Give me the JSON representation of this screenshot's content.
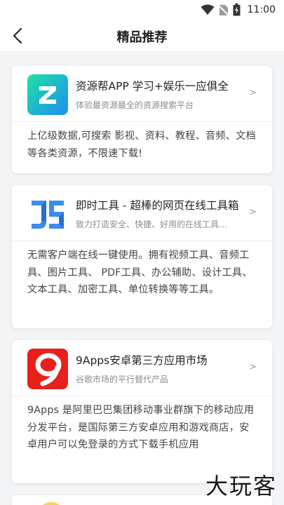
{
  "status_bar": {
    "time": "11:00",
    "icons": [
      "wifi-icon",
      "no-sim-icon",
      "battery-icon"
    ]
  },
  "nav": {
    "title": "精品推荐",
    "back_icon": "chevron-left-icon"
  },
  "cards": [
    {
      "icon": "z-logo",
      "title": "资源帮APP 学习+娱乐一应俱全",
      "subtitle": "体验最资源最全的资源搜索平台",
      "chevron": ">",
      "description": "上亿级数据,可搜索 影视、资料、教程、音频、文档 等各类资源，不限速下载!"
    },
    {
      "icon": "js-logo",
      "title": "即时工具 - 超棒的网页在线工具箱",
      "subtitle": "致力打造安全、快捷、好用的在线工具…",
      "chevron": ">",
      "description": "无需客户端在线一键使用。拥有视频工具、音频工具、图片工具、 PDF工具、办公辅助、设计工具、文本工具、加密工具、单位转换等等工具。"
    },
    {
      "icon": "9apps-logo",
      "title": "9Apps安卓第三方应用市场",
      "subtitle": "谷歌市场的平行替代产品",
      "chevron": ">",
      "description": "9Apps 是阿里巴巴集团移动事业群旗下的移动应用分发平台，是国际第三方安卓应用和游戏商店，安卓用户可以免登录的方式下载手机应用"
    }
  ],
  "watermark": [
    "大",
    "玩",
    "客"
  ],
  "colors": {
    "background": "#f3f4f6",
    "z_gradient_start": "#1fe0a6",
    "z_gradient_end": "#1e8ff2",
    "js_blue": "#3b8cf0",
    "nine_red": "#e8201c"
  }
}
